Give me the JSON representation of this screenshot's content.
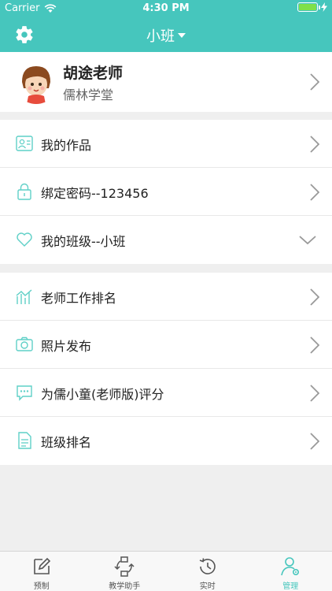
{
  "status_bar": {
    "carrier": "Carrier",
    "time": "4:30 PM"
  },
  "nav": {
    "class_name": "小班"
  },
  "profile": {
    "name": "胡途老师",
    "school": "儒林学堂"
  },
  "group1": [
    {
      "label": "我的作品",
      "icon": "id-card-icon"
    },
    {
      "label": "绑定密码--123456",
      "icon": "lock-icon"
    },
    {
      "label": "我的班级--小班",
      "icon": "heart-icon"
    }
  ],
  "group2": [
    {
      "label": "老师工作排名",
      "icon": "chart-icon"
    },
    {
      "label": "照片发布",
      "icon": "camera-icon"
    },
    {
      "label": "为儒小童(老师版)评分",
      "icon": "chat-icon"
    },
    {
      "label": "班级排名",
      "icon": "document-icon"
    }
  ],
  "tabs": [
    {
      "label": "预制",
      "icon": "edit-icon"
    },
    {
      "label": "教学助手",
      "icon": "sync-icon"
    },
    {
      "label": "实时",
      "icon": "history-icon"
    },
    {
      "label": "管理",
      "icon": "user-settings-icon",
      "active": true
    }
  ],
  "colors": {
    "accent": "#46c6bd",
    "icon_line": "#5fd0c7"
  }
}
